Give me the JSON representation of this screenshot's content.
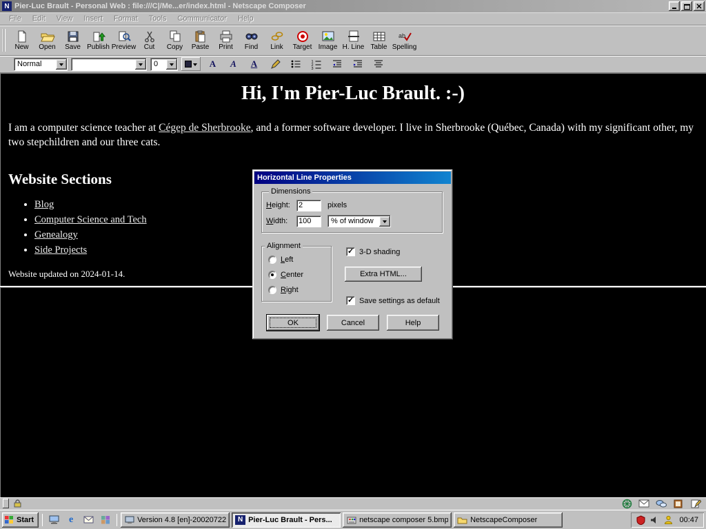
{
  "window": {
    "title": "Pier-Luc Brault - Personal Web : file:///C|/Me...er/index.html - Netscape Composer"
  },
  "menu": {
    "items": [
      "File",
      "Edit",
      "View",
      "Insert",
      "Format",
      "Tools",
      "Communicator",
      "Help"
    ]
  },
  "toolbar": {
    "items": [
      {
        "label": "New",
        "icon": "new-document-icon"
      },
      {
        "label": "Open",
        "icon": "open-folder-icon"
      },
      {
        "label": "Save",
        "icon": "save-floppy-icon"
      },
      {
        "label": "Publish",
        "icon": "publish-icon"
      },
      {
        "label": "Preview",
        "icon": "preview-icon"
      },
      {
        "label": "Cut",
        "icon": "cut-scissors-icon"
      },
      {
        "label": "Copy",
        "icon": "copy-icon"
      },
      {
        "label": "Paste",
        "icon": "paste-clipboard-icon"
      },
      {
        "label": "Print",
        "icon": "print-icon"
      },
      {
        "label": "Find",
        "icon": "find-binoculars-icon"
      },
      {
        "label": "Link",
        "icon": "link-chain-icon"
      },
      {
        "label": "Target",
        "icon": "target-icon"
      },
      {
        "label": "Image",
        "icon": "image-icon"
      },
      {
        "label": "H. Line",
        "icon": "horizontal-line-icon"
      },
      {
        "label": "Table",
        "icon": "table-icon"
      },
      {
        "label": "Spelling",
        "icon": "spelling-check-icon"
      }
    ]
  },
  "formatbar": {
    "paragraph_style": "Normal",
    "font_name": "",
    "font_size": "0",
    "buttons": [
      "bold",
      "italic",
      "underline",
      "remove-styles",
      "bullet-list",
      "numbered-list",
      "decrease-indent",
      "increase-indent",
      "alignment"
    ]
  },
  "document": {
    "heading": "Hi, I'm Pier-Luc Brault. :-)",
    "intro_before_link": "I am a computer science teacher at ",
    "intro_link": "Cégep de Sherbrooke",
    "intro_after_link": ", and a former software developer. I live in Sherbrooke (Québec, Canada) with my significant other, my two stepchildren and our three cats.",
    "sections_heading": "Website Sections",
    "section_links": [
      "Blog",
      "Computer Science and Tech",
      "Genealogy",
      "Side Projects"
    ],
    "updated_note": "Website updated on 2024-01-14."
  },
  "dialog": {
    "title": "Horizontal Line Properties",
    "dimensions": {
      "legend": "Dimensions",
      "height_label": "Height:",
      "height_value": "2",
      "height_unit": "pixels",
      "width_label": "Width:",
      "width_value": "100",
      "width_unit_selected": "% of window"
    },
    "alignment": {
      "legend": "Alignment",
      "options": [
        "Left",
        "Center",
        "Right"
      ],
      "selected": "Center"
    },
    "shading": {
      "label": "3-D shading",
      "checked": true
    },
    "extra_html_label": "Extra HTML...",
    "save_default": {
      "label": "Save settings as default",
      "checked": true
    },
    "buttons": {
      "ok": "OK",
      "cancel": "Cancel",
      "help": "Help"
    }
  },
  "statusbar": {
    "left_icons": [
      "component-bar-handle",
      "security-lock-icon"
    ],
    "component_icons": [
      "navigator-icon",
      "inbox-icon",
      "newsgroups-icon",
      "address-book-icon",
      "composer-icon"
    ]
  },
  "taskbar": {
    "start_label": "Start",
    "quicklaunch_icons": [
      "show-desktop-icon",
      "internet-explorer-icon",
      "outlook-mail-icon",
      "channels-icon"
    ],
    "tasks": [
      {
        "label": "Version 4.8 [en]-20020722...",
        "icon": "installer-icon",
        "active": false
      },
      {
        "label": "Pier-Luc Brault - Pers...",
        "icon": "netscape-icon",
        "active": true
      },
      {
        "label": "netscape composer 5.bmp...",
        "icon": "paint-icon",
        "active": false
      },
      {
        "label": "NetscapeComposer",
        "icon": "folder-icon",
        "active": false
      }
    ],
    "tray_icons": [
      "antivirus-icon",
      "volume-icon",
      "user-icon"
    ],
    "clock": "00:47"
  },
  "colors": {
    "window_face": "#c0c0c0",
    "active_titlebar_start": "#000080",
    "active_titlebar_end": "#1084d0",
    "inactive_titlebar_start": "#7d7d7d",
    "inactive_titlebar_end": "#b8b8b8",
    "page_background": "#000000",
    "page_text": "#ffffff",
    "link_color": "#e9e9e9"
  }
}
